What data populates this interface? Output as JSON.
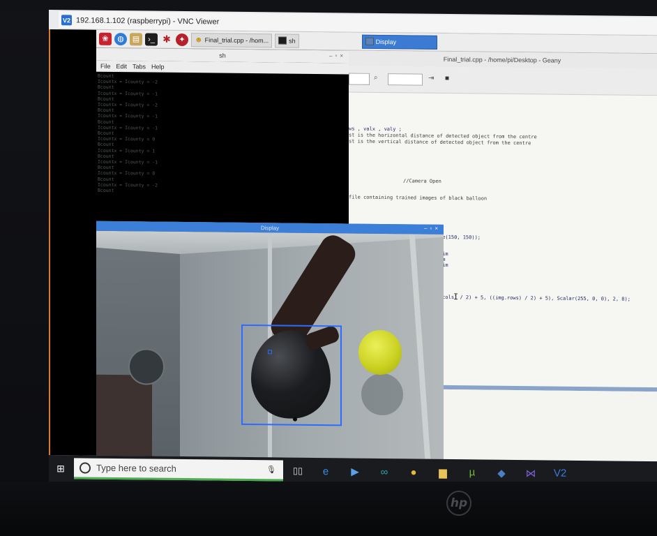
{
  "vnc": {
    "title": "192.168.1.102 (raspberrypi) - VNC Viewer",
    "badge": "V2"
  },
  "pi_taskbar": {
    "tasks": [
      {
        "label": "Final_trial.cpp - /hom..."
      },
      {
        "label": "sh"
      },
      {
        "label": "Display"
      }
    ]
  },
  "terminal": {
    "title": "sh",
    "menu": [
      "File",
      "Edit",
      "Tabs",
      "Help"
    ],
    "lines": [
      "Bcount",
      "Icountx = Icounty = -2",
      "Bcount",
      "Icountx = Icounty = -1",
      "Bcount",
      "Icountx = Icounty = -2",
      "Bcount",
      "Icountx = Icounty = -1",
      "Bcount",
      "Icountx = Icounty = -1",
      "Bcount",
      "Icountx = Icounty = 0",
      "Bcount",
      "Icountx = Icounty = 1",
      "Bcount",
      "Icountx = Icounty = -1",
      "Bcount",
      "Icountx = Icounty = 0",
      "Bcount",
      "Icountx = Icounty = -2",
      "Bcount"
    ]
  },
  "display_window": {
    "title": "Display"
  },
  "geany": {
    "title": "Final_trial.cpp - /home/pi/Desktop - Geany",
    "code_lines": [
      {
        "text": "ws , valx , valy ;",
        "kind": "code"
      },
      {
        "text": "st is the horizontal distance of detected object from the centre",
        "kind": "cmt"
      },
      {
        "text": "st is the vertical distance of detected object from the centre",
        "kind": "cmt"
      },
      {
        "text": "//Camera Open",
        "kind": "cmt"
      },
      {
        "text": "file containing trained images of black balloon",
        "kind": "cmt"
      },
      {
        "text": "ze(150, 150));",
        "kind": "code"
      },
      {
        "text": "m",
        "kind": "code"
      },
      {
        "text": "aim",
        "kind": "code"
      },
      {
        "text": "im",
        "kind": "code"
      },
      {
        "text": "aim",
        "kind": "code"
      },
      {
        "text": ".cols) / 2) + 5, ((img.rows) / 2) + 5), Scalar(255, 0, 0), 2, 8);",
        "kind": "code"
      }
    ]
  },
  "windows_taskbar": {
    "search_placeholder": "Type here to search",
    "apps": [
      {
        "icon": "edge-icon",
        "glyph": "e",
        "color": "#3a8ee6",
        "running": false
      },
      {
        "icon": "media-icon",
        "glyph": "▶",
        "color": "#5aa0e6",
        "running": false
      },
      {
        "icon": "arduino-icon",
        "glyph": "∞",
        "color": "#2aa6a6",
        "running": false
      },
      {
        "icon": "chrome-icon",
        "glyph": "●",
        "color": "#e8b73a",
        "running": false
      },
      {
        "icon": "folder-icon",
        "glyph": "▆",
        "color": "#e8c35a",
        "running": false
      },
      {
        "icon": "utorrent-icon",
        "glyph": "µ",
        "color": "#6cbf3a",
        "running": true
      },
      {
        "icon": "python-icon",
        "glyph": "◆",
        "color": "#4a7fc0",
        "running": false
      },
      {
        "icon": "visual-studio-icon",
        "glyph": "⋈",
        "color": "#7a5cd6",
        "running": false
      },
      {
        "icon": "vnc-icon",
        "glyph": "V2",
        "color": "#3a7ae0",
        "running": true
      }
    ]
  },
  "bezel": {
    "logo": "hp"
  }
}
